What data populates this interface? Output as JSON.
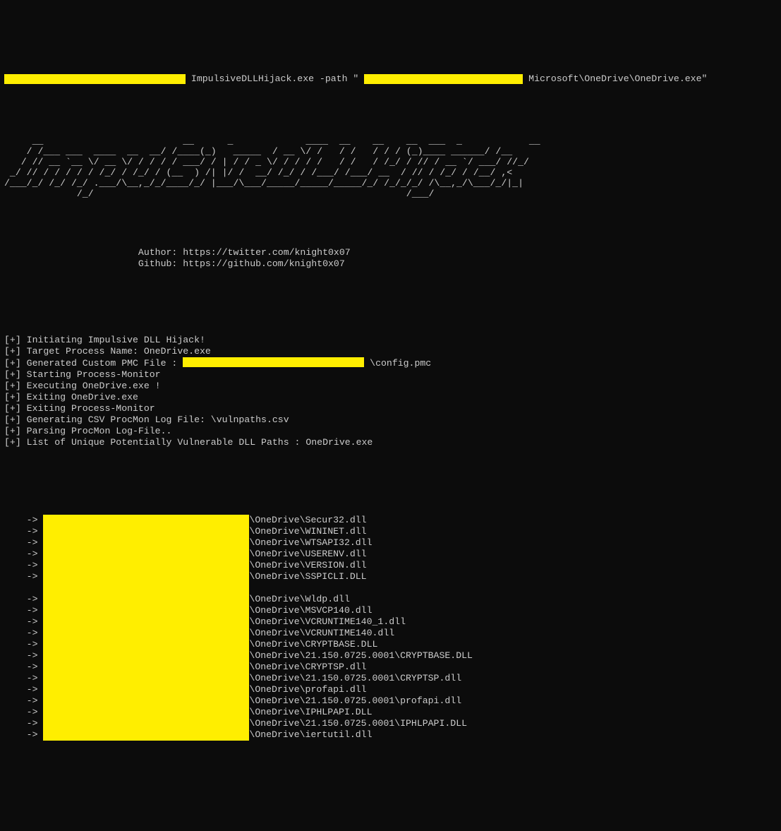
{
  "command": {
    "redact1_width": 257,
    "exe": " ImpulsiveDLLHijack.exe -path \" ",
    "redact2_width": 225,
    "tail": " Microsoft\\OneDrive\\OneDrive.exe\""
  },
  "ascii_art": "     __                         __      _             ____  __    __    __  ___  _            __  \n    / /___ ___  ____  __  __/ /____(_)   _____  / __ \\/ /   / /   / / / (_)____ ______/ /__\n   / // __ `__ \\/ __ \\/ / / / / ___/ / | / / _ \\/ / / / /   / /   / /_/ / // / __ `/ ___/ //_/\n _/ // / / / / / /_/ / /_/ / (__  ) /| |/ /  __/ /_/ / /___/ /___/ __  / // / /_/ / /__/ ,<   \n/___/_/ /_/ /_/ .___/\\__,_/_/____/_/ |___/\\___/_____/_____/_____/_/ /_/_/_/ /\\__,_/\\___/_/|_|  \n             /_/                                                        /___/               ",
  "meta": {
    "author_line": "                        Author: https://twitter.com/knight0x07",
    "github_line": "                        Github: https://github.com/knight0x07"
  },
  "log_lines": [
    "[+] Initiating Impulsive DLL Hijack!",
    "[+] Target Process Name: OneDrive.exe"
  ],
  "pmc_line": {
    "prefix": "[+] Generated Custom PMC File : ",
    "redact_width": 257,
    "suffix": " \\config.pmc"
  },
  "log_lines2": [
    "[+] Starting Process-Monitor",
    "[+] Executing OneDrive.exe !",
    "[+] Exiting OneDrive.exe",
    "[+] Exiting Process-Monitor",
    "[+] Generating CSV ProcMon Log File: \\vulnpaths.csv",
    "[+] Parsing ProcMon Log-File..",
    "[+] List of Unique Potentially Vulnerable DLL Paths : OneDrive.exe"
  ],
  "arrow": "    -> ",
  "paths": [
    "\\OneDrive\\Secur32.dll",
    "\\OneDrive\\WININET.dll",
    "\\OneDrive\\WTSAPI32.dll",
    "\\OneDrive\\USERENV.dll",
    "\\OneDrive\\VERSION.dll",
    "\\OneDrive\\SSPICLI.DLL",
    "",
    "\\OneDrive\\Wldp.dll",
    "\\OneDrive\\MSVCP140.dll",
    "\\OneDrive\\VCRUNTIME140_1.dll",
    "\\OneDrive\\VCRUNTIME140.dll",
    "\\OneDrive\\CRYPTBASE.DLL",
    "\\OneDrive\\21.150.0725.0001\\CRYPTBASE.DLL",
    "\\OneDrive\\CRYPTSP.dll",
    "\\OneDrive\\21.150.0725.0001\\CRYPTSP.dll",
    "\\OneDrive\\profapi.dll",
    "\\OneDrive\\21.150.0725.0001\\profapi.dll",
    "\\OneDrive\\IPHLPAPI.DLL",
    "\\OneDrive\\21.150.0725.0001\\IPHLPAPI.DLL",
    "\\OneDrive\\iertutil.dll"
  ]
}
